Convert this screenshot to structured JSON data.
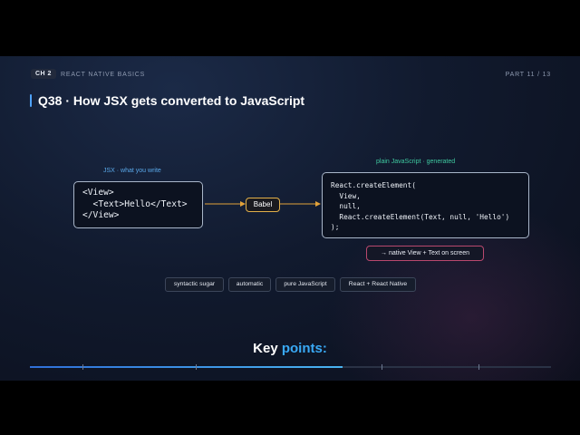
{
  "header": {
    "chapter_chip": "CH 2",
    "chapter_name": "REACT NATIVE BASICS",
    "part": "PART 11 / 13"
  },
  "title": "Q38 · How JSX gets converted to JavaScript",
  "jsx_panel": {
    "caption": "JSX · what you write",
    "lines": [
      "<View>",
      "  <Text>Hello</Text>",
      "</View>"
    ]
  },
  "transform": {
    "label": "Babel"
  },
  "js_panel": {
    "caption": "plain JavaScript · generated",
    "lines": [
      "React.createElement(",
      "  View,",
      "  null,",
      "  React.createElement(Text, null, 'Hello')",
      ");"
    ]
  },
  "result": "→ native View + Text on screen",
  "tags": [
    "syntactic sugar",
    "automatic",
    "pure JavaScript",
    "React + React Native"
  ],
  "key_points": {
    "word1": "Key",
    "word2": "points:"
  },
  "progress": {
    "fraction": 0.6
  },
  "colors": {
    "accent_blue": "#4fa3ff",
    "caption_blue": "#5aa9ea",
    "caption_green": "#3fc9a0",
    "babel_border": "#e2b04a",
    "arrow_orange": "#e2a23a",
    "result_border": "#b8486e"
  }
}
